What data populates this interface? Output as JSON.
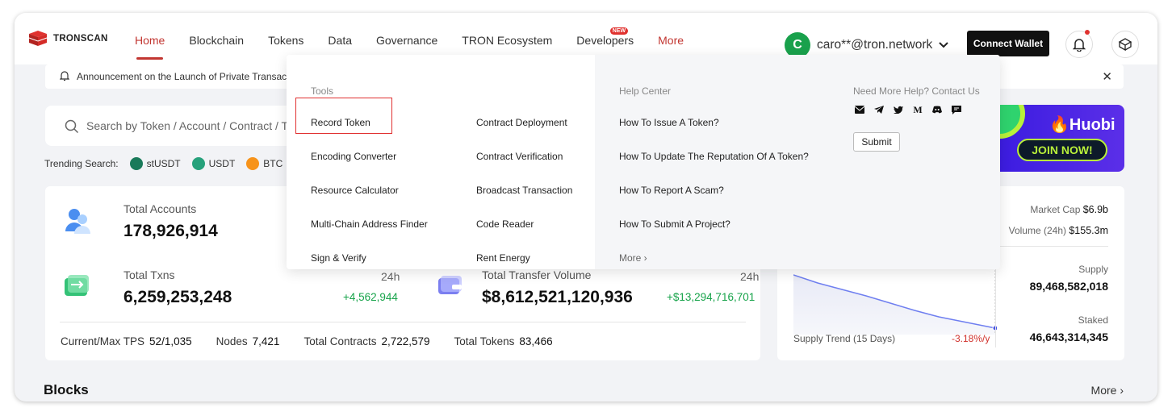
{
  "nav": {
    "logo_text": "TRONSCAN",
    "menu": [
      "Home",
      "Blockchain",
      "Tokens",
      "Data",
      "Governance",
      "TRON Ecosystem",
      "Developers",
      "More"
    ],
    "new_badge": "NEW",
    "avatar_letter": "C",
    "user_email": "caro**@tron.network",
    "connect_wallet": "Connect Wallet"
  },
  "announcement": {
    "text": "Announcement on the Launch of Private Transacti"
  },
  "search": {
    "placeholder": "Search by Token / Account / Contract / Tx"
  },
  "trending": {
    "label": "Trending Search:",
    "items": [
      "stUSDT",
      "USDT",
      "BTC"
    ]
  },
  "banner": {
    "brand": "Huobi",
    "cta": "JOIN NOW!"
  },
  "stats": {
    "total_accounts_label": "Total Accounts",
    "total_accounts": "178,926,914",
    "total_txns_label": "Total Txns",
    "total_txns": "6,259,253,248",
    "txns_period": "24h",
    "txns_delta": "+4,562,944",
    "transfer_label": "Total Transfer Volume",
    "transfer_value": "$8,612,521,120,936",
    "transfer_period": "24h",
    "transfer_delta": "+$13,294,716,701",
    "tps_label": "Current/Max TPS",
    "tps_value": "52/1,035",
    "nodes_label": "Nodes",
    "nodes_value": "7,421",
    "contracts_label": "Total Contracts",
    "contracts_value": "2,722,579",
    "tokens_label": "Total Tokens",
    "tokens_value": "83,466"
  },
  "trx_card": {
    "market_cap_label": "Market Cap",
    "market_cap": "$6.9b",
    "volume_label": "Volume (24h)",
    "volume": "$155.3m",
    "supply_label": "Supply",
    "supply": "89,468,582,018",
    "staked_label": "Staked",
    "staked": "46,643,314,345",
    "trend_label": "Supply Trend (15 Days)",
    "trend_pct": "-3.18%/y"
  },
  "blocks": {
    "title": "Blocks",
    "more": "More"
  },
  "dropdown": {
    "tools_header": "Tools",
    "tools_col1": [
      "Record Token",
      "Encoding Converter",
      "Resource Calculator",
      "Multi-Chain Address Finder",
      "Sign & Verify"
    ],
    "tools_col2": [
      "Contract Deployment",
      "Contract Verification",
      "Broadcast Transaction",
      "Code Reader",
      "Rent Energy"
    ],
    "help_header": "Help Center",
    "help_items": [
      "How To Issue A Token?",
      "How To Update The Reputation Of A Token?",
      "How To Report A Scam?",
      "How To Submit A Project?",
      "More"
    ],
    "contact_header": "Need More Help? Contact Us",
    "submit": "Submit"
  },
  "colors": {
    "accent": "#c23631",
    "green": "#17a34a",
    "red": "#d0302b"
  }
}
